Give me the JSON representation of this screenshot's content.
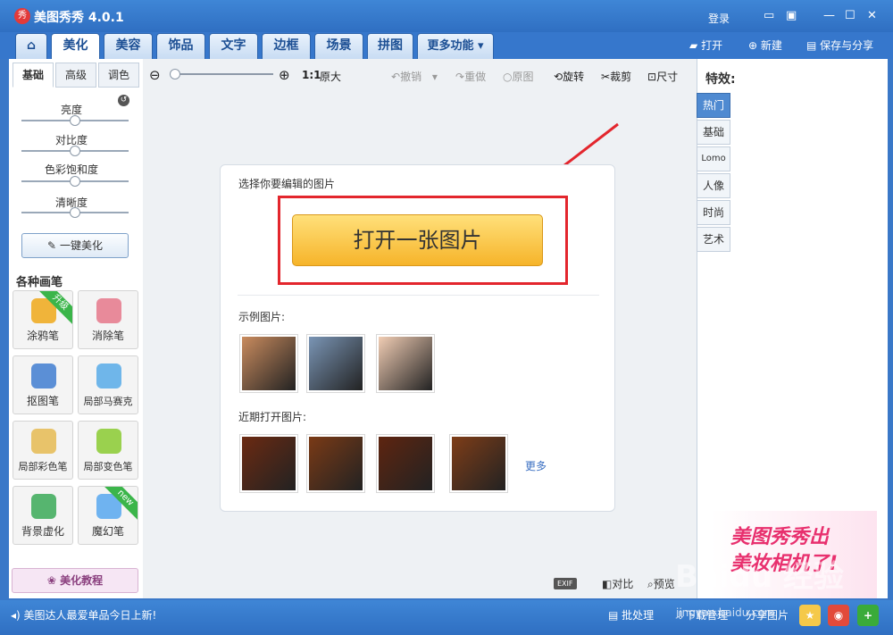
{
  "app": {
    "logo": "秀",
    "title": "美图秀秀 4.0.1",
    "login": "登录",
    "window_icons": [
      "chat-icon",
      "menu-icon",
      "minimize-icon",
      "maximize-icon",
      "close-icon"
    ]
  },
  "nav": {
    "home_icon": "home-icon",
    "tabs": [
      "美化",
      "美容",
      "饰品",
      "文字",
      "边框",
      "场景",
      "拼图",
      "更多功能"
    ],
    "actions": {
      "open": "打开",
      "new": "新建",
      "save_share": "保存与分享"
    }
  },
  "left": {
    "subtabs": [
      "基础",
      "高级",
      "调色"
    ],
    "sliders": [
      {
        "label": "亮度",
        "value": 0.5
      },
      {
        "label": "对比度",
        "value": 0.5
      },
      {
        "label": "色彩饱和度",
        "value": 0.5
      },
      {
        "label": "清晰度",
        "value": 0.5
      }
    ],
    "one_click": "一键美化",
    "brushes_title": "各种画笔",
    "brushes": [
      {
        "label": "涂鸦笔",
        "badge": "升级",
        "color": "#f0b43a"
      },
      {
        "label": "消除笔",
        "badge": "",
        "color": "#e88a9a"
      },
      {
        "label": "抠图笔",
        "badge": "",
        "color": "#5b8fd6"
      },
      {
        "label": "局部马赛克",
        "badge": "",
        "color": "#6fb6ea"
      },
      {
        "label": "局部彩色笔",
        "badge": "",
        "color": "#e8c36a"
      },
      {
        "label": "局部变色笔",
        "badge": "",
        "color": "#9ad14e"
      },
      {
        "label": "背景虚化",
        "badge": "",
        "color": "#56b56f"
      },
      {
        "label": "魔幻笔",
        "badge": "new",
        "color": "#6fb3f0"
      }
    ],
    "tutorial": "美化教程"
  },
  "toolbar": {
    "zoom_out": "zoom-out-icon",
    "zoom_in": "zoom-in-icon",
    "ratio": "1:1",
    "original_size": "原大",
    "undo": "撤销",
    "redo": "重做",
    "original": "原图",
    "rotate": "旋转",
    "crop": "裁剪",
    "size": "尺寸"
  },
  "dialog": {
    "prompt": "选择你要编辑的图片",
    "open_button": "打开一张图片",
    "samples_title": "示例图片:",
    "samples": [
      {
        "color": "#c98b5e"
      },
      {
        "color": "#7a95b5"
      },
      {
        "color": "#f1cdb4"
      }
    ],
    "recent_title": "近期打开图片:",
    "recent": [
      {
        "color": "#6b2a12"
      },
      {
        "color": "#7a3a16"
      },
      {
        "color": "#5e2510"
      },
      {
        "color": "#7e3d18"
      }
    ],
    "more": "更多"
  },
  "bottom_tools": {
    "exif": "EXIF",
    "compare": "对比",
    "preview": "预览"
  },
  "effects": {
    "title": "特效:",
    "items": [
      "热门",
      "基础",
      "Lomo",
      "人像",
      "时尚",
      "艺术"
    ],
    "active": "热门"
  },
  "promo": {
    "line1": "美图秀秀出",
    "line2": "美妆相机了!"
  },
  "status": {
    "news": "美图达人最爱单品今日上新!",
    "batch": "批处理",
    "download_mgr": "下载管理",
    "share": "分享图片"
  },
  "watermark": {
    "text": "Baidu 经验",
    "url": "jingyan.baidu.com"
  },
  "colors": {
    "accent": "#2f6fc2",
    "highlight": "#e3262d",
    "button": "#f6b42a"
  }
}
